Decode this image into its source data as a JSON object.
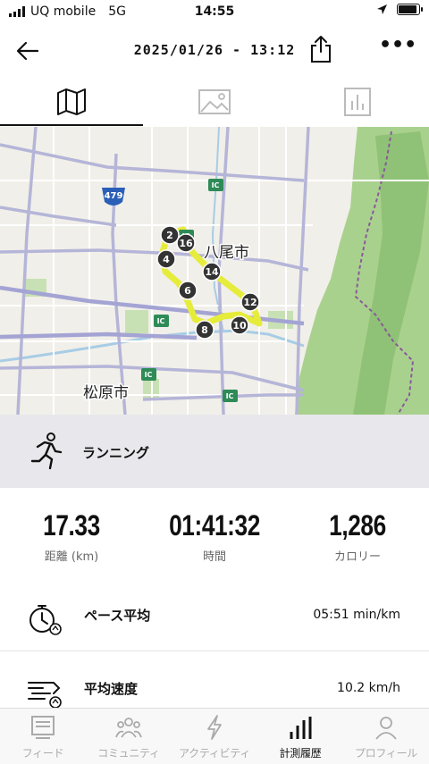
{
  "status_bar": {
    "carrier": "UQ mobile",
    "network": "5G",
    "time": "14:55"
  },
  "header": {
    "title": "2025/01/26 - 13:12"
  },
  "tabs": [
    {
      "name": "map",
      "icon": "map-icon",
      "active": true
    },
    {
      "name": "photo",
      "icon": "image-icon",
      "active": false
    },
    {
      "name": "chart",
      "icon": "chart-icon",
      "active": false
    }
  ],
  "map": {
    "place_labels": [
      "八尾市",
      "松原市"
    ],
    "road_badges": [
      "479",
      "IC",
      "IC",
      "IC",
      "IC",
      "IC"
    ],
    "km_markers": [
      "2",
      "16",
      "4",
      "14",
      "6",
      "12",
      "8",
      "10"
    ],
    "route_color": "#e6ec3a"
  },
  "activity": {
    "label": "ランニング"
  },
  "stats": [
    {
      "value": "17.33",
      "label": "距離 (km)"
    },
    {
      "value": "01:41:32",
      "label": "時間"
    },
    {
      "value": "1,286",
      "label": "カロリー"
    }
  ],
  "details": [
    {
      "label": "ペース平均",
      "value": "05:51 min/km",
      "icon": "stopwatch-icon"
    },
    {
      "label": "平均速度",
      "value": "10.2 km/h",
      "icon": "speed-icon"
    }
  ],
  "bottom_nav": [
    {
      "label": "フィード",
      "icon": "feed-icon",
      "active": false
    },
    {
      "label": "コミュニティ",
      "icon": "community-icon",
      "active": false
    },
    {
      "label": "アクティビティ",
      "icon": "bolt-icon",
      "active": false
    },
    {
      "label": "計測履歴",
      "icon": "history-icon",
      "active": true
    },
    {
      "label": "プロフィール",
      "icon": "profile-icon",
      "active": false
    }
  ]
}
